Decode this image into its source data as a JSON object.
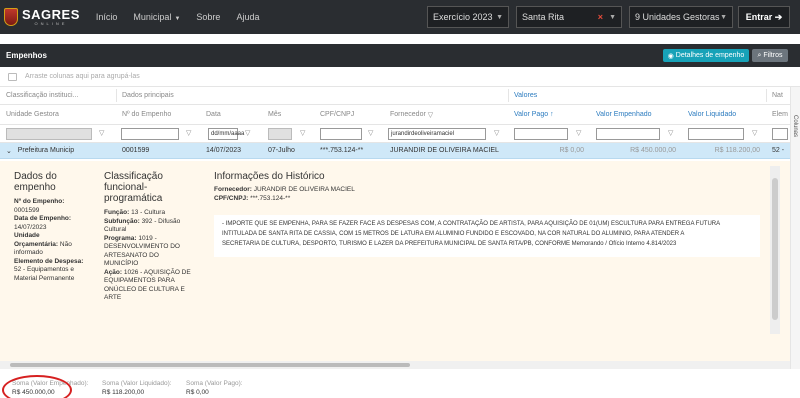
{
  "navbar": {
    "logo_title": "SAGRES",
    "logo_sub": "ONLINE",
    "links": [
      "Início",
      "Municipal",
      "Sobre",
      "Ajuda"
    ],
    "exercicio_label": "Exercício",
    "exercicio_value": "2023",
    "municipio": "Santa Rita",
    "unidades": "9 Unidades Gestoras",
    "entrar": "Entrar"
  },
  "panel": {
    "title": "Empenhos",
    "detalhes_button": "Detalhes de empenho",
    "filtros_button": "Filtros",
    "group_placeholder": "Arraste colunas aqui para agrupá-las",
    "side_tab": "Colunas"
  },
  "grid": {
    "bands": {
      "classificacao": "Classificação instituci...",
      "dados": "Dados principais",
      "valores": "Valores",
      "nat": "Nat"
    },
    "columns": {
      "unidade": "Unidade Gestora",
      "numero": "Nº do Empenho",
      "data": "Data",
      "mes": "Mês",
      "cpf": "CPF/CNPJ",
      "fornecedor": "Fornecedor",
      "pago": "Valor Pago",
      "empenhado": "Valor Empenhado",
      "liquidado": "Valor Liquidado",
      "elem": "Elem"
    },
    "filters": {
      "data_placeholder": "dd/mm/aaaa",
      "fornecedor": "jurandirdeoliveiramaciel"
    },
    "row": {
      "unidade": "Prefeitura Municip",
      "numero": "0001599",
      "data": "14/07/2023",
      "mes": "07-Julho",
      "cpf": "***.753.124-**",
      "fornecedor": "JURANDIR DE OLIVEIRA MACIEL",
      "pago": "R$ 0,00",
      "empenhado": "R$ 450.000,00",
      "liquidado": "R$ 118.200,00",
      "elem": "52 -"
    }
  },
  "detail": {
    "dados": {
      "title_1": "Dados do",
      "title_2": "empenho",
      "numero_label": "Nº do Empenho:",
      "numero_value": "0001599",
      "data_label": "Data de Empenho:",
      "data_value": "14/07/2023",
      "unidade_label_1": "Unidade",
      "unidade_label_2": "Orçamentária:",
      "unidade_value_1": "Não",
      "unidade_value_2": "informado",
      "elemento_label": "Elemento de Despesa:",
      "elemento_value_1": "52 - Equipamentos e",
      "elemento_value_2": "Material Permanente"
    },
    "classificacao": {
      "title_1": "Classificação",
      "title_2": "funcional-",
      "title_3": "programática",
      "funcao_label": "Função:",
      "funcao_value": "13 - Cultura",
      "subfuncao_label": "Subfunção:",
      "subfuncao_value_1": "392 - Difusão",
      "subfuncao_value_2": "Cultural",
      "programa_label": "Programa:",
      "programa_value_1": "1019 -",
      "programa_value_2": "DESENVOLVIMENTO DO",
      "programa_value_3": "ARTESANATO DO",
      "programa_value_4": "MUNICÍPIO",
      "acao_label": "Ação:",
      "acao_value_1": "1026 - AQUISIÇÃO DE",
      "acao_value_2": "EQUIPAMENTOS PARA",
      "acao_value_3": "ONÚCLEO DE CULTURA E",
      "acao_value_4": "ARTE"
    },
    "historico": {
      "title": "Informações do Histórico",
      "fornecedor_label": "Fornecedor:",
      "fornecedor_value": "JURANDIR DE OLIVEIRA MACIEL",
      "cpf_label": "CPF/CNPJ:",
      "cpf_value": "***.753.124-**",
      "text_1": "- IMPORTE QUE SE EMPENHA, PARA SE FAZER FACE AS DESPESAS COM, A CONTRATAÇÃO DE ARTISTA, PARA AQUISIÇÃO DE 01(UM) ESCULTURA PARA ENTREGA FUTURA",
      "text_2": "INTITULADA DE SANTA RITA DE CASSIA, COM 15 METROS DE LATURA EM ALUMINIO FUNDIDO E ESCOVADO, NA COR NATURAL DO ALUMINIO, PARA ATENDER A",
      "text_3": "SECRETARIA DE CULTURA, DESPORTO, TURISMO E LAZER DA PREFEITURA MUNICIPAL DE SANTA RITA/PB, CONFORME Memorando / Ofício Interno 4.814/2023"
    }
  },
  "footer": {
    "sum_empenhado_label": "Soma (Valor Empenhado):",
    "sum_empenhado_value": "R$ 450.000,00",
    "sum_liquidado_label": "Soma (Valor Liquidado):",
    "sum_liquidado_value": "R$ 118.200,00",
    "sum_pago_label": "Soma (Valor Pago):",
    "sum_pago_value": "R$ 0,00"
  },
  "colors": {
    "navbar": "#2a2d31",
    "selected_row": "#cfe8f8",
    "detail_bg": "#fff8ec",
    "accent_blue": "#2b7bbf",
    "detalhes_button": "#17a2b8",
    "annotation_circle": "#d62020"
  }
}
